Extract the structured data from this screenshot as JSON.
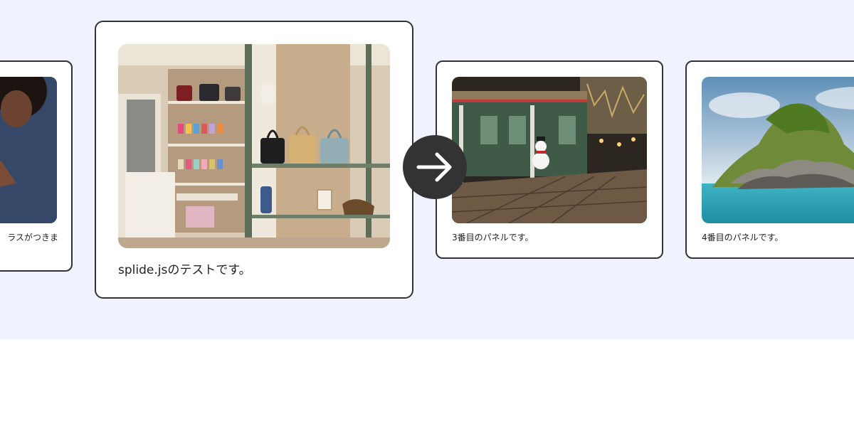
{
  "carousel": {
    "slides": [
      {
        "caption": "ラスがつきま",
        "image": "woman-at-counter-photo"
      },
      {
        "caption": "splide.jsのテストです。",
        "image": "boutique-handbag-shelves-photo"
      },
      {
        "caption": "3番目のパネルです。",
        "image": "festive-street-storefront-photo"
      },
      {
        "caption": "4番目のパネルです。",
        "image": "rocky-island-sea-photo"
      }
    ],
    "next_arrow_icon": "arrow-right-icon"
  },
  "colors": {
    "background": "#f0f2fe",
    "card_border": "#333333",
    "arrow_bg": "#333333",
    "arrow_fg": "#ffffff"
  }
}
